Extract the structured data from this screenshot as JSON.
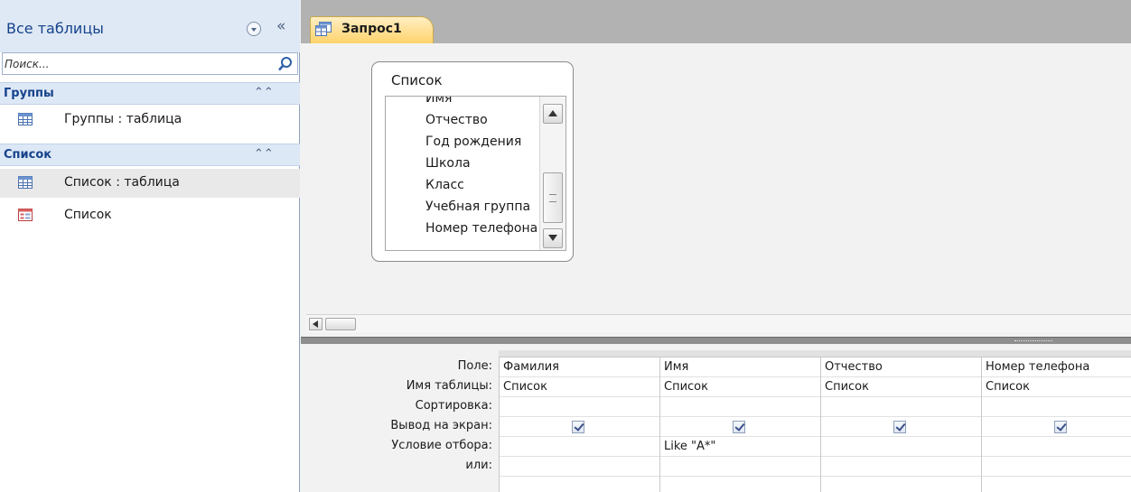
{
  "nav": {
    "title": "Все таблицы",
    "search_placeholder": "Поиск...",
    "groups": [
      {
        "label": "Группы",
        "items": [
          {
            "label": "Группы : таблица",
            "icon": "table-icon"
          }
        ]
      },
      {
        "label": "Список",
        "items": [
          {
            "label": "Список : таблица",
            "icon": "table-icon"
          },
          {
            "label": "Список",
            "icon": "form-icon"
          }
        ]
      }
    ]
  },
  "document": {
    "tab_label": "Запрос1",
    "table_box": {
      "title": "Список",
      "fields": [
        "Имя",
        "Отчество",
        "Год рождения",
        "Школа",
        "Класс",
        "Учебная группа",
        "Номер телефона"
      ]
    }
  },
  "grid": {
    "row_labels": [
      "Поле:",
      "Имя таблицы:",
      "Сортировка:",
      "Вывод на экран:",
      "Условие отбора:",
      "или:"
    ],
    "columns": [
      {
        "field": "Фамилия",
        "table": "Список",
        "sort": "",
        "show": true,
        "criteria": "",
        "or": ""
      },
      {
        "field": "Имя",
        "table": "Список",
        "sort": "",
        "show": true,
        "criteria": "Like \"А*\"",
        "or": ""
      },
      {
        "field": "Отчество",
        "table": "Список",
        "sort": "",
        "show": true,
        "criteria": "",
        "or": ""
      },
      {
        "field": "Номер телефона",
        "table": "Список",
        "sort": "",
        "show": true,
        "criteria": "",
        "or": ""
      }
    ]
  },
  "colors": {
    "nav_header_bg": "#dfe9f5",
    "group_text": "#15428b",
    "tab_gradient_top": "#ffeec2",
    "tab_gradient_bottom": "#ffd36b"
  }
}
